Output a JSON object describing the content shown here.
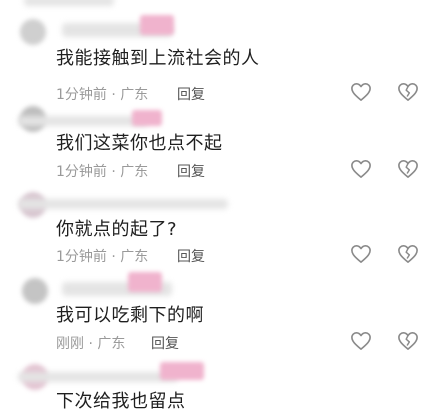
{
  "comments": [
    {
      "text": "我能接触到上流社会的人",
      "meta": "1分钟前 · 广东",
      "reply": "回复"
    },
    {
      "text": "我们这菜你也点不起",
      "meta": "1分钟前 · 广东",
      "reply": "回复"
    },
    {
      "text": "你就点的起了?",
      "meta": "1分钟前 · 广东",
      "reply": "回复"
    },
    {
      "text": "我可以吃剩下的啊",
      "meta": "刚刚 · 广东",
      "reply": "回复"
    },
    {
      "text": "下次给我也留点",
      "meta": "",
      "reply": ""
    }
  ],
  "icons": {
    "like": "heart-outline-icon",
    "dislike": "broken-heart-outline-icon"
  },
  "colors": {
    "text": "#1f1f1f",
    "meta": "#9a9a9a",
    "icon": "#8a8a8a",
    "redaction_pink": "#f0b3cd"
  }
}
